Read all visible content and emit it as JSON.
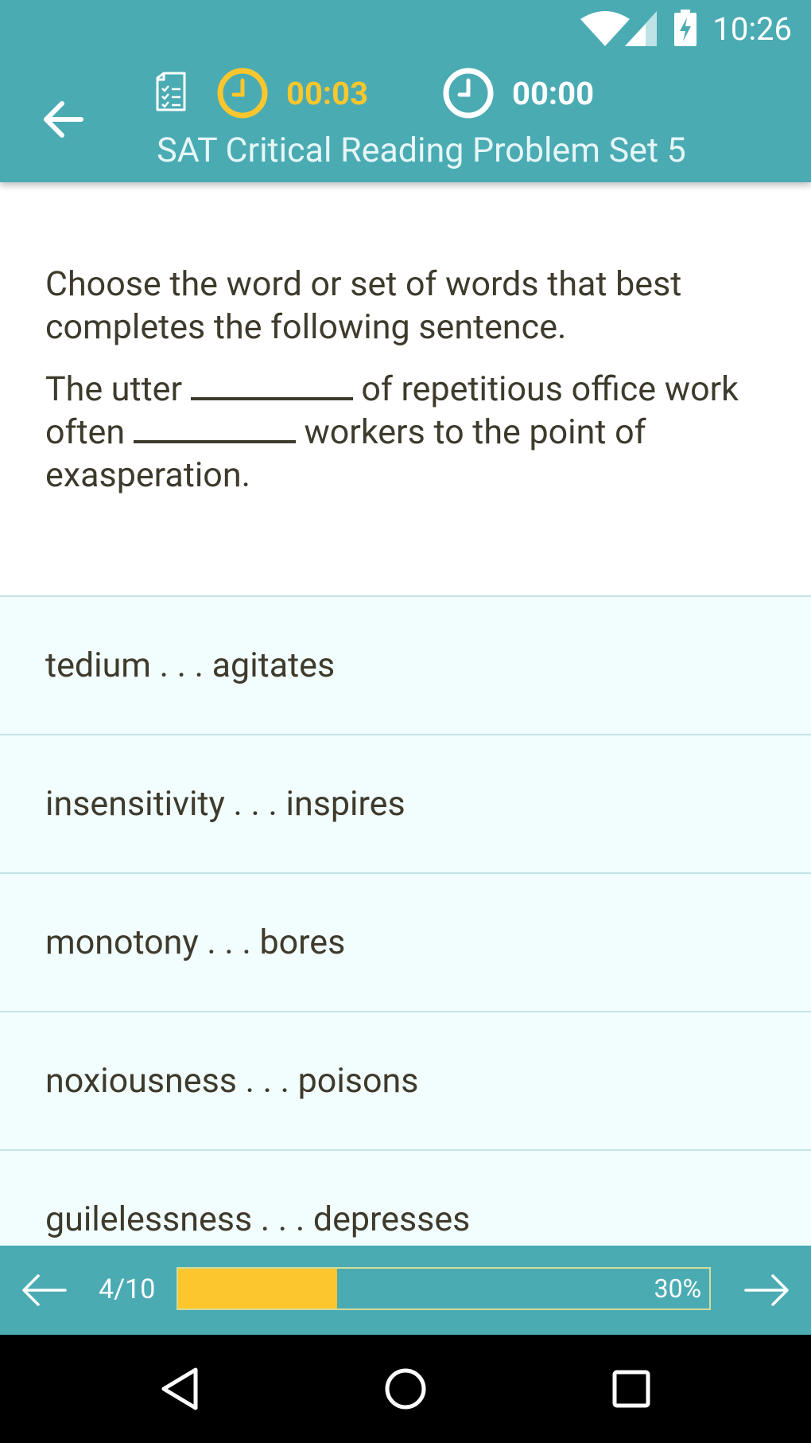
{
  "status_bar": {
    "time": "10:26"
  },
  "header": {
    "title": "SAT Critical Reading Problem Set 5",
    "question_timer": "00:03",
    "total_timer": "00:00"
  },
  "question": {
    "prompt": "Choose the word or set of words that best completes the following sentence.",
    "sentence_part1": "The utter",
    "sentence_part2": "of repetitious office work often",
    "sentence_part3": "workers to the point of exasperation."
  },
  "answers": [
    {
      "label": "tedium . . . agitates"
    },
    {
      "label": "insensitivity . . . inspires"
    },
    {
      "label": "monotony . . . bores"
    },
    {
      "label": "noxiousness . . . poisons"
    },
    {
      "label": "guilelessness . . . depresses"
    }
  ],
  "footer": {
    "page_counter": "4/10",
    "progress_label": "30%",
    "progress_value": 0.3
  },
  "colors": {
    "accent": "#4aabb3",
    "timer_active": "#fcc62d",
    "progress_fill": "#fcc62d"
  },
  "icons": {
    "back": "arrow-left-icon",
    "checklist": "checklist-icon",
    "clock": "clock-icon",
    "previous": "arrow-left-icon",
    "next": "arrow-right-icon"
  }
}
